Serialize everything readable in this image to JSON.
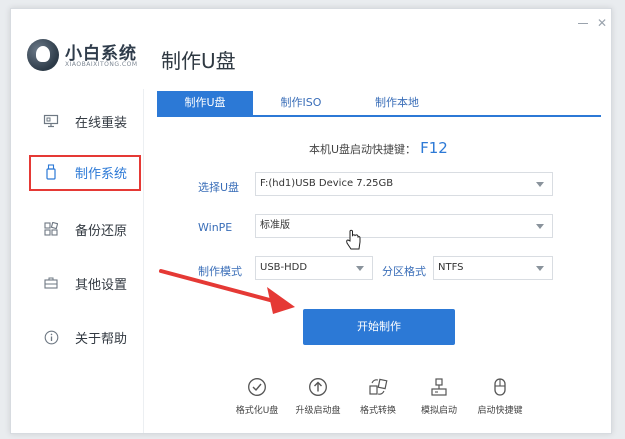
{
  "app": {
    "name": "小白系统",
    "subtitle": "XIAOBAIXITONG.COM"
  },
  "page": {
    "title": "制作U盘"
  },
  "sidebar": {
    "items": [
      {
        "label": "在线重装",
        "icon": "monitor-icon"
      },
      {
        "label": "制作系统",
        "icon": "usb-drive-icon",
        "active": true
      },
      {
        "label": "备份还原",
        "icon": "grid-restore-icon"
      },
      {
        "label": "其他设置",
        "icon": "briefcase-icon"
      },
      {
        "label": "关于帮助",
        "icon": "info-icon"
      }
    ]
  },
  "tabs": [
    {
      "label": "制作U盘",
      "active": true
    },
    {
      "label": "制作ISO"
    },
    {
      "label": "制作本地"
    }
  ],
  "shortcut": {
    "label": "本机U盘启动快捷键：",
    "key": "F12"
  },
  "form": {
    "usb": {
      "label": "选择U盘",
      "value": "F:(hd1)USB Device 7.25GB"
    },
    "winpe": {
      "label": "WinPE",
      "value": "标准版"
    },
    "mode": {
      "label": "制作模式",
      "value": "USB-HDD"
    },
    "partition": {
      "label": "分区格式",
      "value": "NTFS"
    }
  },
  "start_button": {
    "label": "开始制作"
  },
  "tools": [
    {
      "label": "格式化U盘",
      "icon": "check-circle-icon"
    },
    {
      "label": "升级启动盘",
      "icon": "upload-circle-icon"
    },
    {
      "label": "格式转换",
      "icon": "convert-icon"
    },
    {
      "label": "模拟启动",
      "icon": "simulate-icon"
    },
    {
      "label": "启动快捷键",
      "icon": "mouse-icon"
    }
  ],
  "colors": {
    "accent": "#2c79d6",
    "highlight": "#e53935"
  }
}
